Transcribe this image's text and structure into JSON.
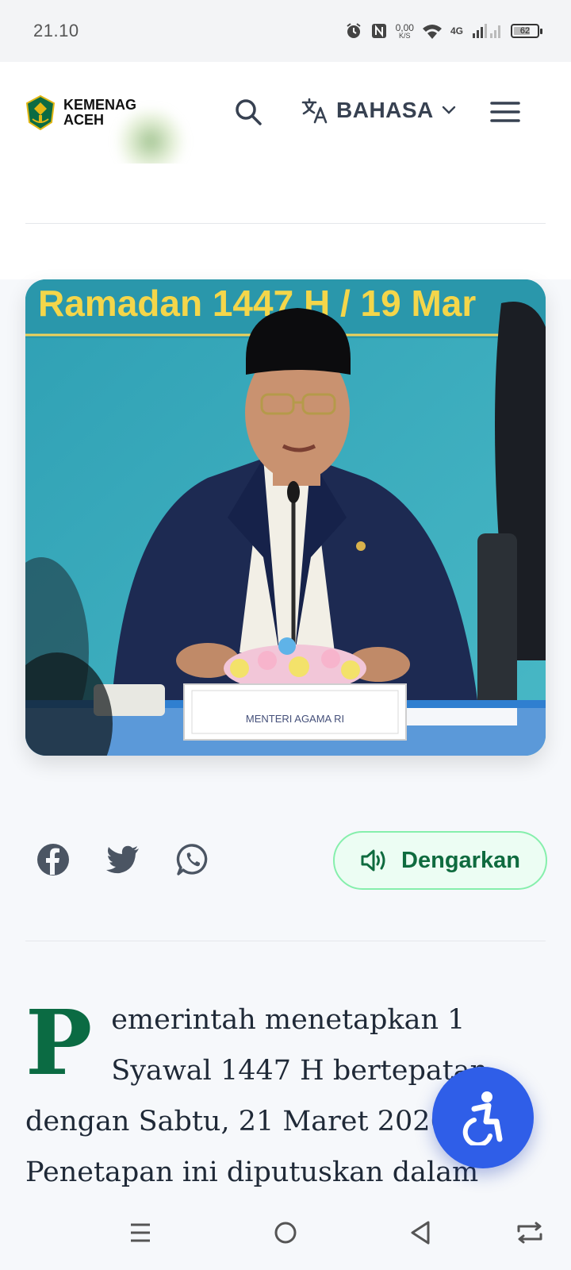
{
  "status_bar": {
    "time": "21.10",
    "net_speed_value": "0,00",
    "net_speed_unit": "K/S",
    "network_type": "4G",
    "battery_level": "62"
  },
  "header": {
    "logo_line1": "KEMENAG",
    "logo_line2": "ACEH",
    "language_label": "BAHASA"
  },
  "hero_image": {
    "banner_text": "Ramadan 1447 H / 19 Mar",
    "nameplate_text": "MENTERI AGAMA RI"
  },
  "share": {
    "listen_label": "Dengarkan"
  },
  "article": {
    "dropcap": "P",
    "body": "emerintah menetapkan 1 Syawal 1447 H bertepatan dengan Sabtu, 21 Maret 2026. Penetapan ini diputuskan dalam"
  },
  "colors": {
    "accent_green": "#0b6b43",
    "listen_bg": "#ecfdf3",
    "listen_border": "#86efac",
    "a11y_blue": "#2f5ee8",
    "hero_bg": "#38a6b8"
  },
  "icons": {
    "status": [
      "alarm-icon",
      "nfc-icon",
      "wifi-icon",
      "signal-icon",
      "battery-icon"
    ],
    "header": [
      "search-icon",
      "translate-icon",
      "chevron-down-icon",
      "hamburger-menu-icon"
    ],
    "share": [
      "facebook-icon",
      "twitter-icon",
      "whatsapp-icon",
      "speaker-icon"
    ],
    "nav": [
      "recents-icon",
      "home-icon",
      "back-icon",
      "rotate-icon"
    ]
  }
}
